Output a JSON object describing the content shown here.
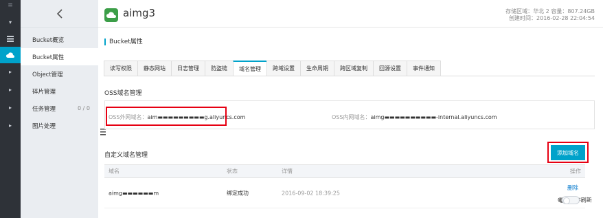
{
  "header": {
    "bucket_name": "aimg3",
    "region_line": "存储区域：华北 2   容量：807.24GB",
    "created_line": "创建时间：2016-02-28 22:04:54"
  },
  "subnav": {
    "items": [
      {
        "label": "Bucket概览"
      },
      {
        "label": "Bucket属性"
      },
      {
        "label": "Object管理"
      },
      {
        "label": "碎片管理"
      },
      {
        "label": "任务管理",
        "count": "0 / 0"
      },
      {
        "label": "图片处理"
      }
    ],
    "active_index": 1
  },
  "section_title": "Bucket属性",
  "tabs": [
    {
      "label": "读写权限"
    },
    {
      "label": "静态网站"
    },
    {
      "label": "日志管理"
    },
    {
      "label": "防盗链"
    },
    {
      "label": "域名管理"
    },
    {
      "label": "跨域设置"
    },
    {
      "label": "生命周期"
    },
    {
      "label": "跨区域复制"
    },
    {
      "label": "回源设置"
    },
    {
      "label": "事件通知"
    }
  ],
  "active_tab": "域名管理",
  "oss_domain": {
    "title": "OSS域名管理",
    "external_label": "OSS外网域名：",
    "external_value": "aim▬▬▬▬▬▬▬▬▬g.aliyuncs.com",
    "internal_label": "OSS内网域名：",
    "internal_value": "aimg▬▬▬▬▬▬▬▬▬▬-internal.aliyuncs.com"
  },
  "custom_domain": {
    "title": "自定义域名管理",
    "add_button": "添加域名",
    "columns": [
      "域名",
      "状态",
      "详情",
      "操作"
    ],
    "rows": [
      {
        "domain": "aimg▬▬▬▬▬▬m",
        "status": "绑定成功",
        "detail": "2016-09-02 18:39:25",
        "action": "删除",
        "cdn_label": "CDN缓存刷新"
      }
    ]
  },
  "colors": {
    "accent": "#00a2ca",
    "annotation_red": "#e60012",
    "rail_bg": "#2e3238",
    "subnav_bg": "#eaedf1"
  }
}
